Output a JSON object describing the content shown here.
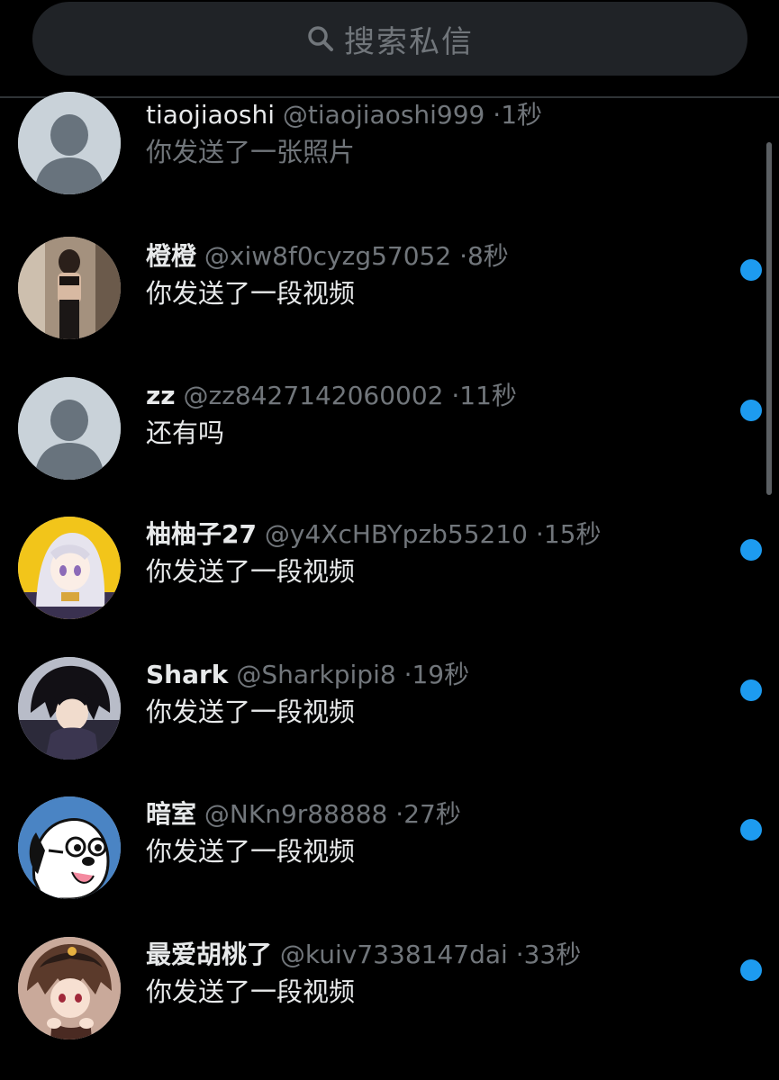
{
  "search": {
    "placeholder": "搜索私信",
    "icon": "search-icon"
  },
  "conversations": [
    {
      "name": "tiaojiaoshi",
      "handle": "@tiaojiaoshi999",
      "time": "1秒",
      "preview": "你发送了一张照片",
      "unread": false,
      "avatar": "default-avatar"
    },
    {
      "name": "橙橙",
      "handle": "@xiw8f0cyzg57052",
      "time": "8秒",
      "preview": "你发送了一段视频",
      "unread": true,
      "avatar": "photo-avatar"
    },
    {
      "name": "zz",
      "handle": "@zz8427142060002",
      "time": "11秒",
      "preview": "还有吗",
      "unread": true,
      "avatar": "default-avatar"
    },
    {
      "name": "柚柚子27",
      "handle": "@y4XcHBYpzb55210",
      "time": "15秒",
      "preview": "你发送了一段视频",
      "unread": true,
      "avatar": "anime-avatar"
    },
    {
      "name": "Shark",
      "handle": "@Sharkpipi8",
      "time": "19秒",
      "preview": "你发送了一段视频",
      "unread": true,
      "avatar": "anime-avatar"
    },
    {
      "name": "暗室",
      "handle": "@NKn9r88888",
      "time": "27秒",
      "preview": "你发送了一段视频",
      "unread": true,
      "avatar": "cartoon-dog-avatar"
    },
    {
      "name": "最爱胡桃了",
      "handle": "@kuiv7338147dai",
      "time": "33秒",
      "preview": "你发送了一段视频",
      "unread": true,
      "avatar": "anime-avatar"
    }
  ],
  "separator": "·",
  "colors": {
    "background": "#000000",
    "accent": "#1d9bf0",
    "muted": "#71767b",
    "text": "#e7e9ea"
  }
}
